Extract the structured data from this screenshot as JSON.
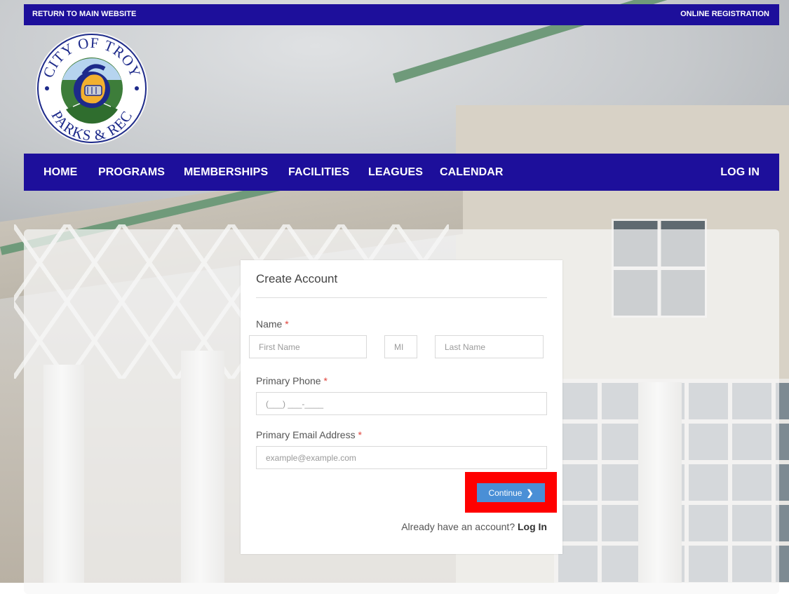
{
  "topbar": {
    "left_link": "RETURN TO MAIN WEBSITE",
    "right_link": "ONLINE REGISTRATION",
    "bg_color": "#1d0f9b"
  },
  "logo": {
    "text_top": "CITY OF TROY",
    "text_bottom": "PARKS & REC",
    "icon": "trojan-helmet-icon"
  },
  "nav": {
    "items": [
      "HOME",
      "PROGRAMS",
      "MEMBERSHIPS",
      "FACILITIES",
      "LEAGUES",
      "CALENDAR"
    ],
    "login": "LOG IN"
  },
  "form": {
    "title": "Create Account",
    "name_label": "Name",
    "required_mark": "*",
    "first_name_placeholder": "First Name",
    "mi_placeholder": "MI",
    "last_name_placeholder": "Last Name",
    "phone_label": "Primary Phone",
    "phone_placeholder": "(___) ___-____",
    "email_label": "Primary Email Address",
    "email_placeholder": "example@example.com",
    "continue_label": "Continue",
    "already_text": "Already have an account?",
    "login_link": "Log In"
  },
  "colors": {
    "accent": "#1d0f9b",
    "button": "#4a8fd6",
    "required": "#e0443c",
    "highlight": "#ff0000"
  }
}
